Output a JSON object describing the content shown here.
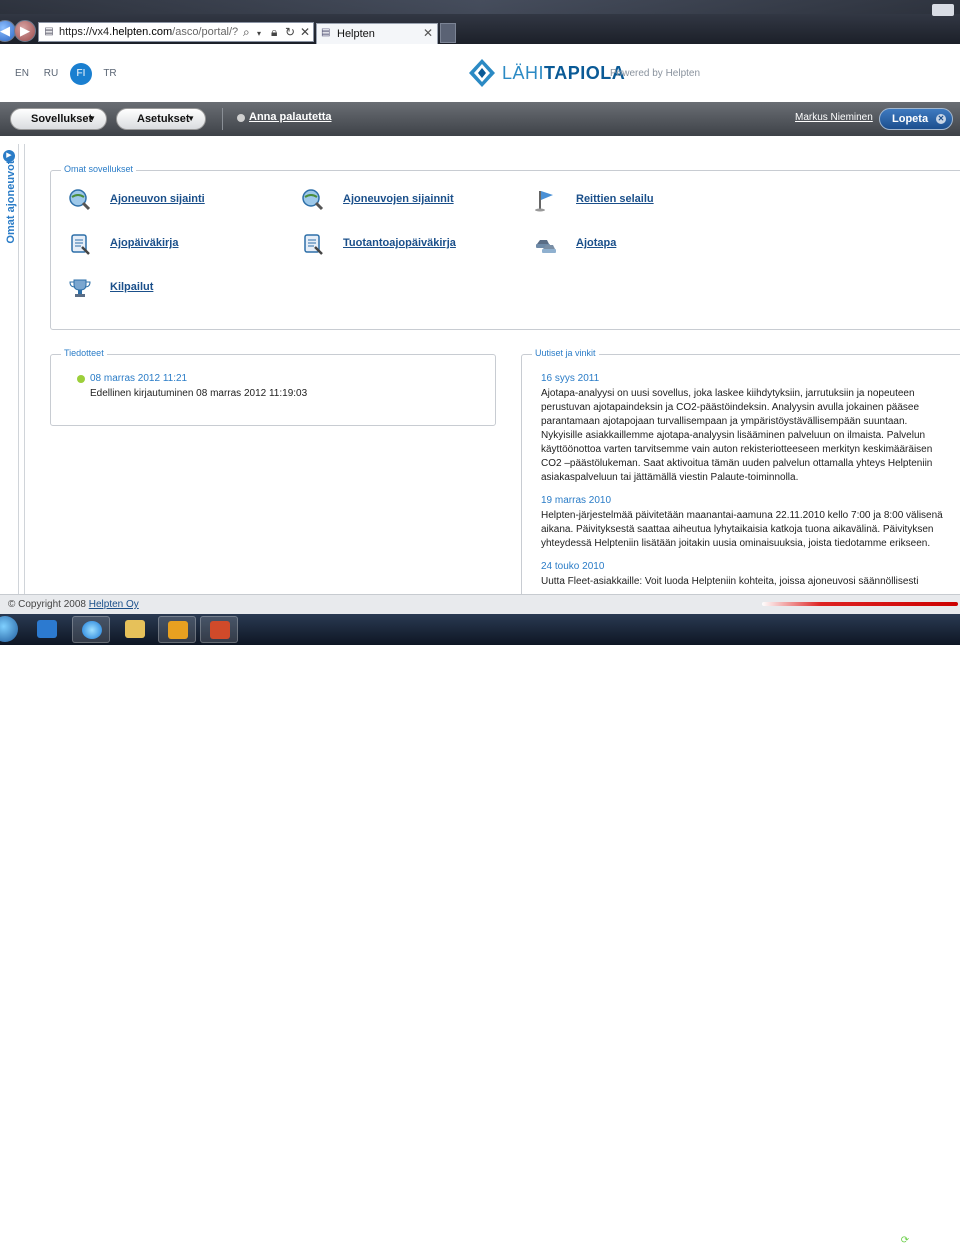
{
  "browser": {
    "url_prefix": "https://vx4.",
    "url_domain": "helpten.com",
    "url_path": "/asco/portal/?",
    "tab_title": "Helpten"
  },
  "header": {
    "languages": [
      {
        "code": "EN",
        "active": false
      },
      {
        "code": "RU",
        "active": false
      },
      {
        "code": "FI",
        "active": true
      },
      {
        "code": "TR",
        "active": false
      }
    ],
    "logo_part1": "LÄHI",
    "logo_part2": "TAPIOLA",
    "powered_by": "Powered by Helpten"
  },
  "navbar": {
    "menu_applications": "Sovellukset",
    "menu_settings": "Asetukset",
    "feedback_link": "Anna palautetta",
    "user_name": "Markus Nieminen",
    "logout_label": "Lopeta"
  },
  "sidebar": {
    "tab_label": "Omat ajoneuvot"
  },
  "my_apps": {
    "legend": "Omat sovellukset",
    "items": [
      {
        "label": "Ajoneuvon sijainti",
        "icon": "globe-magnifier-icon"
      },
      {
        "label": "Ajoneuvojen sijainnit",
        "icon": "globe-magnifier-icon"
      },
      {
        "label": "Reittien selailu",
        "icon": "flag-icon"
      },
      {
        "label": "Ajopäiväkirja",
        "icon": "logbook-icon"
      },
      {
        "label": "Tuotantoajopäiväkirja",
        "icon": "logbook-icon"
      },
      {
        "label": "Ajotapa",
        "icon": "cars-icon"
      },
      {
        "label": "Kilpailut",
        "icon": "trophy-icon"
      }
    ]
  },
  "notices": {
    "legend": "Tiedotteet",
    "date": "08 marras 2012 11:21",
    "text": "Edellinen kirjautuminen 08 marras 2012 11:19:03"
  },
  "news": {
    "legend": "Uutiset ja vinkit",
    "items": [
      {
        "date": "16 syys 2011",
        "body": "Ajotapa-analyysi on uusi sovellus, joka laskee kiihdytyksiin, jarrutuksiin ja nopeuteen perustuvan ajotapaindeksin ja CO2-päästöindeksin. Analyysin avulla jokainen pääsee parantamaan ajotapojaan turvallisempaan ja ympäristöystävällisempään suuntaan. Nykyisille asiakkaillemme ajotapa-analyysin lisääminen palveluun on ilmaista. Palvelun käyttöönottoa varten tarvitsemme vain auton rekisteriotteeseen merkityn keskimääräisen CO2 –päästölukeman. Saat aktivoitua tämän uuden palvelun ottamalla yhteys Helpteniin asiakaspalveluun tai jättämällä viestin Palaute-toiminnolla."
      },
      {
        "date": "19 marras 2010",
        "body": "Helpten-järjestelmää päivitetään maanantai-aamuna 22.11.2010 kello 7:00 ja 8:00 välisenä aikana. Päivityksestä saattaa aiheutua lyhytaikaisia katkoja tuona aikavälinä. Päivityksen yhteydessä Helpteniin lisätään joitakin uusia ominaisuuksia, joista tiedotamme erikseen."
      },
      {
        "date": "24 touko 2010",
        "body": "Uutta Fleet-asiakkaille: Voit luoda Helpteniin kohteita, joissa ajoneuvosi säännöllisesti"
      }
    ]
  },
  "footer": {
    "copyright": "© Copyright 2008",
    "company_link": "Helpten Oy"
  },
  "colors": {
    "accent_blue": "#2a7cc7",
    "link_blue": "#1a4f8a",
    "navbar_dark": "#3e4248"
  }
}
